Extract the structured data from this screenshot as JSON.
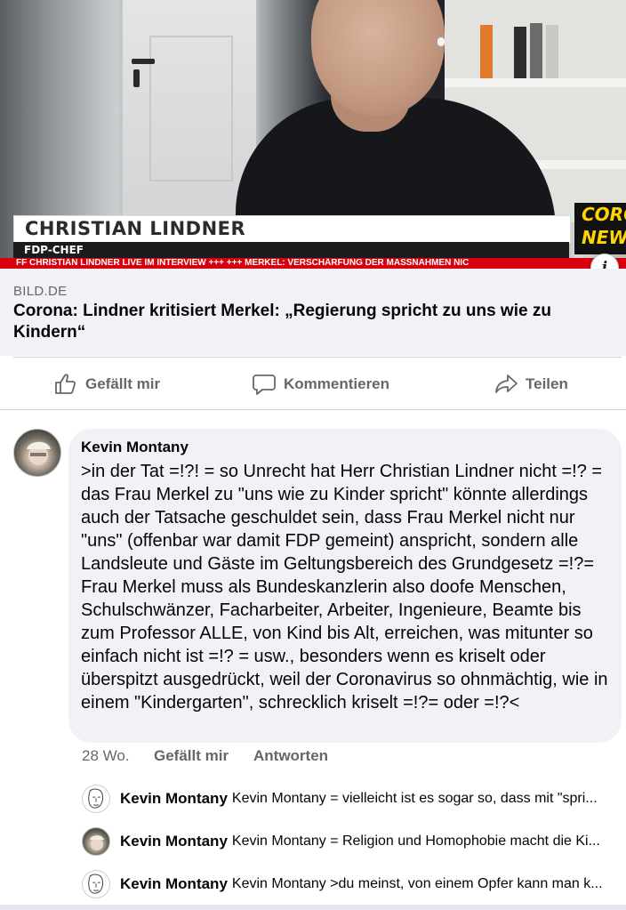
{
  "video": {
    "lower_third_name": "CHRISTIAN LINDNER",
    "lower_third_role": "FDP-CHEF",
    "ticker": "FF CHRISTIAN LINDNER LIVE IM INTERVIEW +++ +++ MERKEL: VERSCHÄRFUNG DER MASSNAHMEN NIC",
    "corner_badge_line1": "CORO",
    "corner_badge_line2": "NEW",
    "info_icon": "info-icon"
  },
  "link_preview": {
    "domain": "BILD.DE",
    "title": "Corona: Lindner kritisiert Merkel: „Regierung spricht zu uns wie zu Kindern“"
  },
  "actions": {
    "like_label": "Gefällt mir",
    "comment_label": "Kommentieren",
    "share_label": "Teilen"
  },
  "comment": {
    "author": "Kevin Montany",
    "text": ">in der Tat =!?! = so Unrecht hat Herr Christian Lindner nicht =!? = das Frau Merkel zu \"uns wie zu Kinder spricht\" könnte allerdings auch der Tatsache geschuldet sein, dass Frau Merkel nicht nur \"uns\" (offenbar war damit FDP gemeint) anspricht, sondern alle Landsleute und Gäste im Geltungsbereich des Grundgesetz =!?= Frau Merkel muss als Bundeskanzlerin also doofe Menschen, Schulschwänzer, Facharbeiter, Arbeiter, Ingenieure, Beamte bis zum Professor ALLE, von Kind bis Alt, erreichen, was mitunter so einfach nicht ist =!? = usw., besonders wenn es kriselt oder überspitzt ausgedrückt, weil der Coronavirus so ohnmächtig, wie in einem \"Kindergarten\", schrecklich kriselt =!?= oder =!?<",
    "time": "28 Wo.",
    "like": "Gefällt mir",
    "reply": "Antworten"
  },
  "replies": [
    {
      "author": "Kevin Montany",
      "text": "Kevin Montany = vielleicht ist es sogar so, dass mit \"spri...",
      "avatar": "sketch"
    },
    {
      "author": "Kevin Montany",
      "text": "Kevin Montany = Religion und Homophobie macht die Ki...",
      "avatar": "photo"
    },
    {
      "author": "Kevin Montany",
      "text": "Kevin Montany >du meinst, von einem Opfer kann man k...",
      "avatar": "sketch"
    }
  ],
  "colors": {
    "accent_red": "#d9000d",
    "secondary_text": "#65676b",
    "bubble_bg": "#f0f2f5"
  }
}
